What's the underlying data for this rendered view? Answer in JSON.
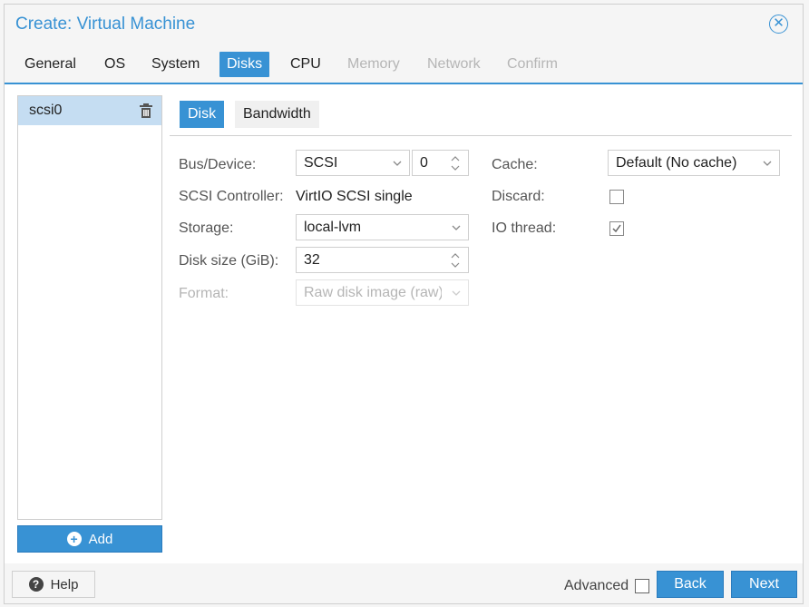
{
  "window": {
    "title": "Create: Virtual Machine"
  },
  "tabs": [
    {
      "label": "General",
      "state": "normal"
    },
    {
      "label": "OS",
      "state": "normal"
    },
    {
      "label": "System",
      "state": "normal"
    },
    {
      "label": "Disks",
      "state": "active"
    },
    {
      "label": "CPU",
      "state": "normal"
    },
    {
      "label": "Memory",
      "state": "disabled"
    },
    {
      "label": "Network",
      "state": "disabled"
    },
    {
      "label": "Confirm",
      "state": "disabled"
    }
  ],
  "disk_list": {
    "items": [
      {
        "label": "scsi0",
        "selected": true
      }
    ],
    "add_label": "Add"
  },
  "subtabs": {
    "disk": "Disk",
    "bandwidth": "Bandwidth"
  },
  "form": {
    "bus_device": {
      "label": "Bus/Device:",
      "bus": "SCSI",
      "device": "0"
    },
    "scsi_controller": {
      "label": "SCSI Controller:",
      "value": "VirtIO SCSI single"
    },
    "storage": {
      "label": "Storage:",
      "value": "local-lvm"
    },
    "disk_size": {
      "label": "Disk size (GiB):",
      "value": "32"
    },
    "format": {
      "label": "Format:",
      "value": "Raw disk image (raw)"
    },
    "cache": {
      "label": "Cache:",
      "value": "Default (No cache)"
    },
    "discard": {
      "label": "Discard:",
      "checked": false
    },
    "io_thread": {
      "label": "IO thread:",
      "checked": true
    }
  },
  "footer": {
    "help_label": "Help",
    "advanced_label": "Advanced",
    "advanced_checked": false,
    "back_label": "Back",
    "next_label": "Next"
  },
  "colors": {
    "accent": "#3892d4",
    "selected_row": "#c5ddf2",
    "disabled_text": "#b5b5b5"
  },
  "icons": [
    "close-icon",
    "trash-icon",
    "plus-icon",
    "help-icon",
    "chevron-down-icon",
    "spinner-icon",
    "check-icon"
  ]
}
